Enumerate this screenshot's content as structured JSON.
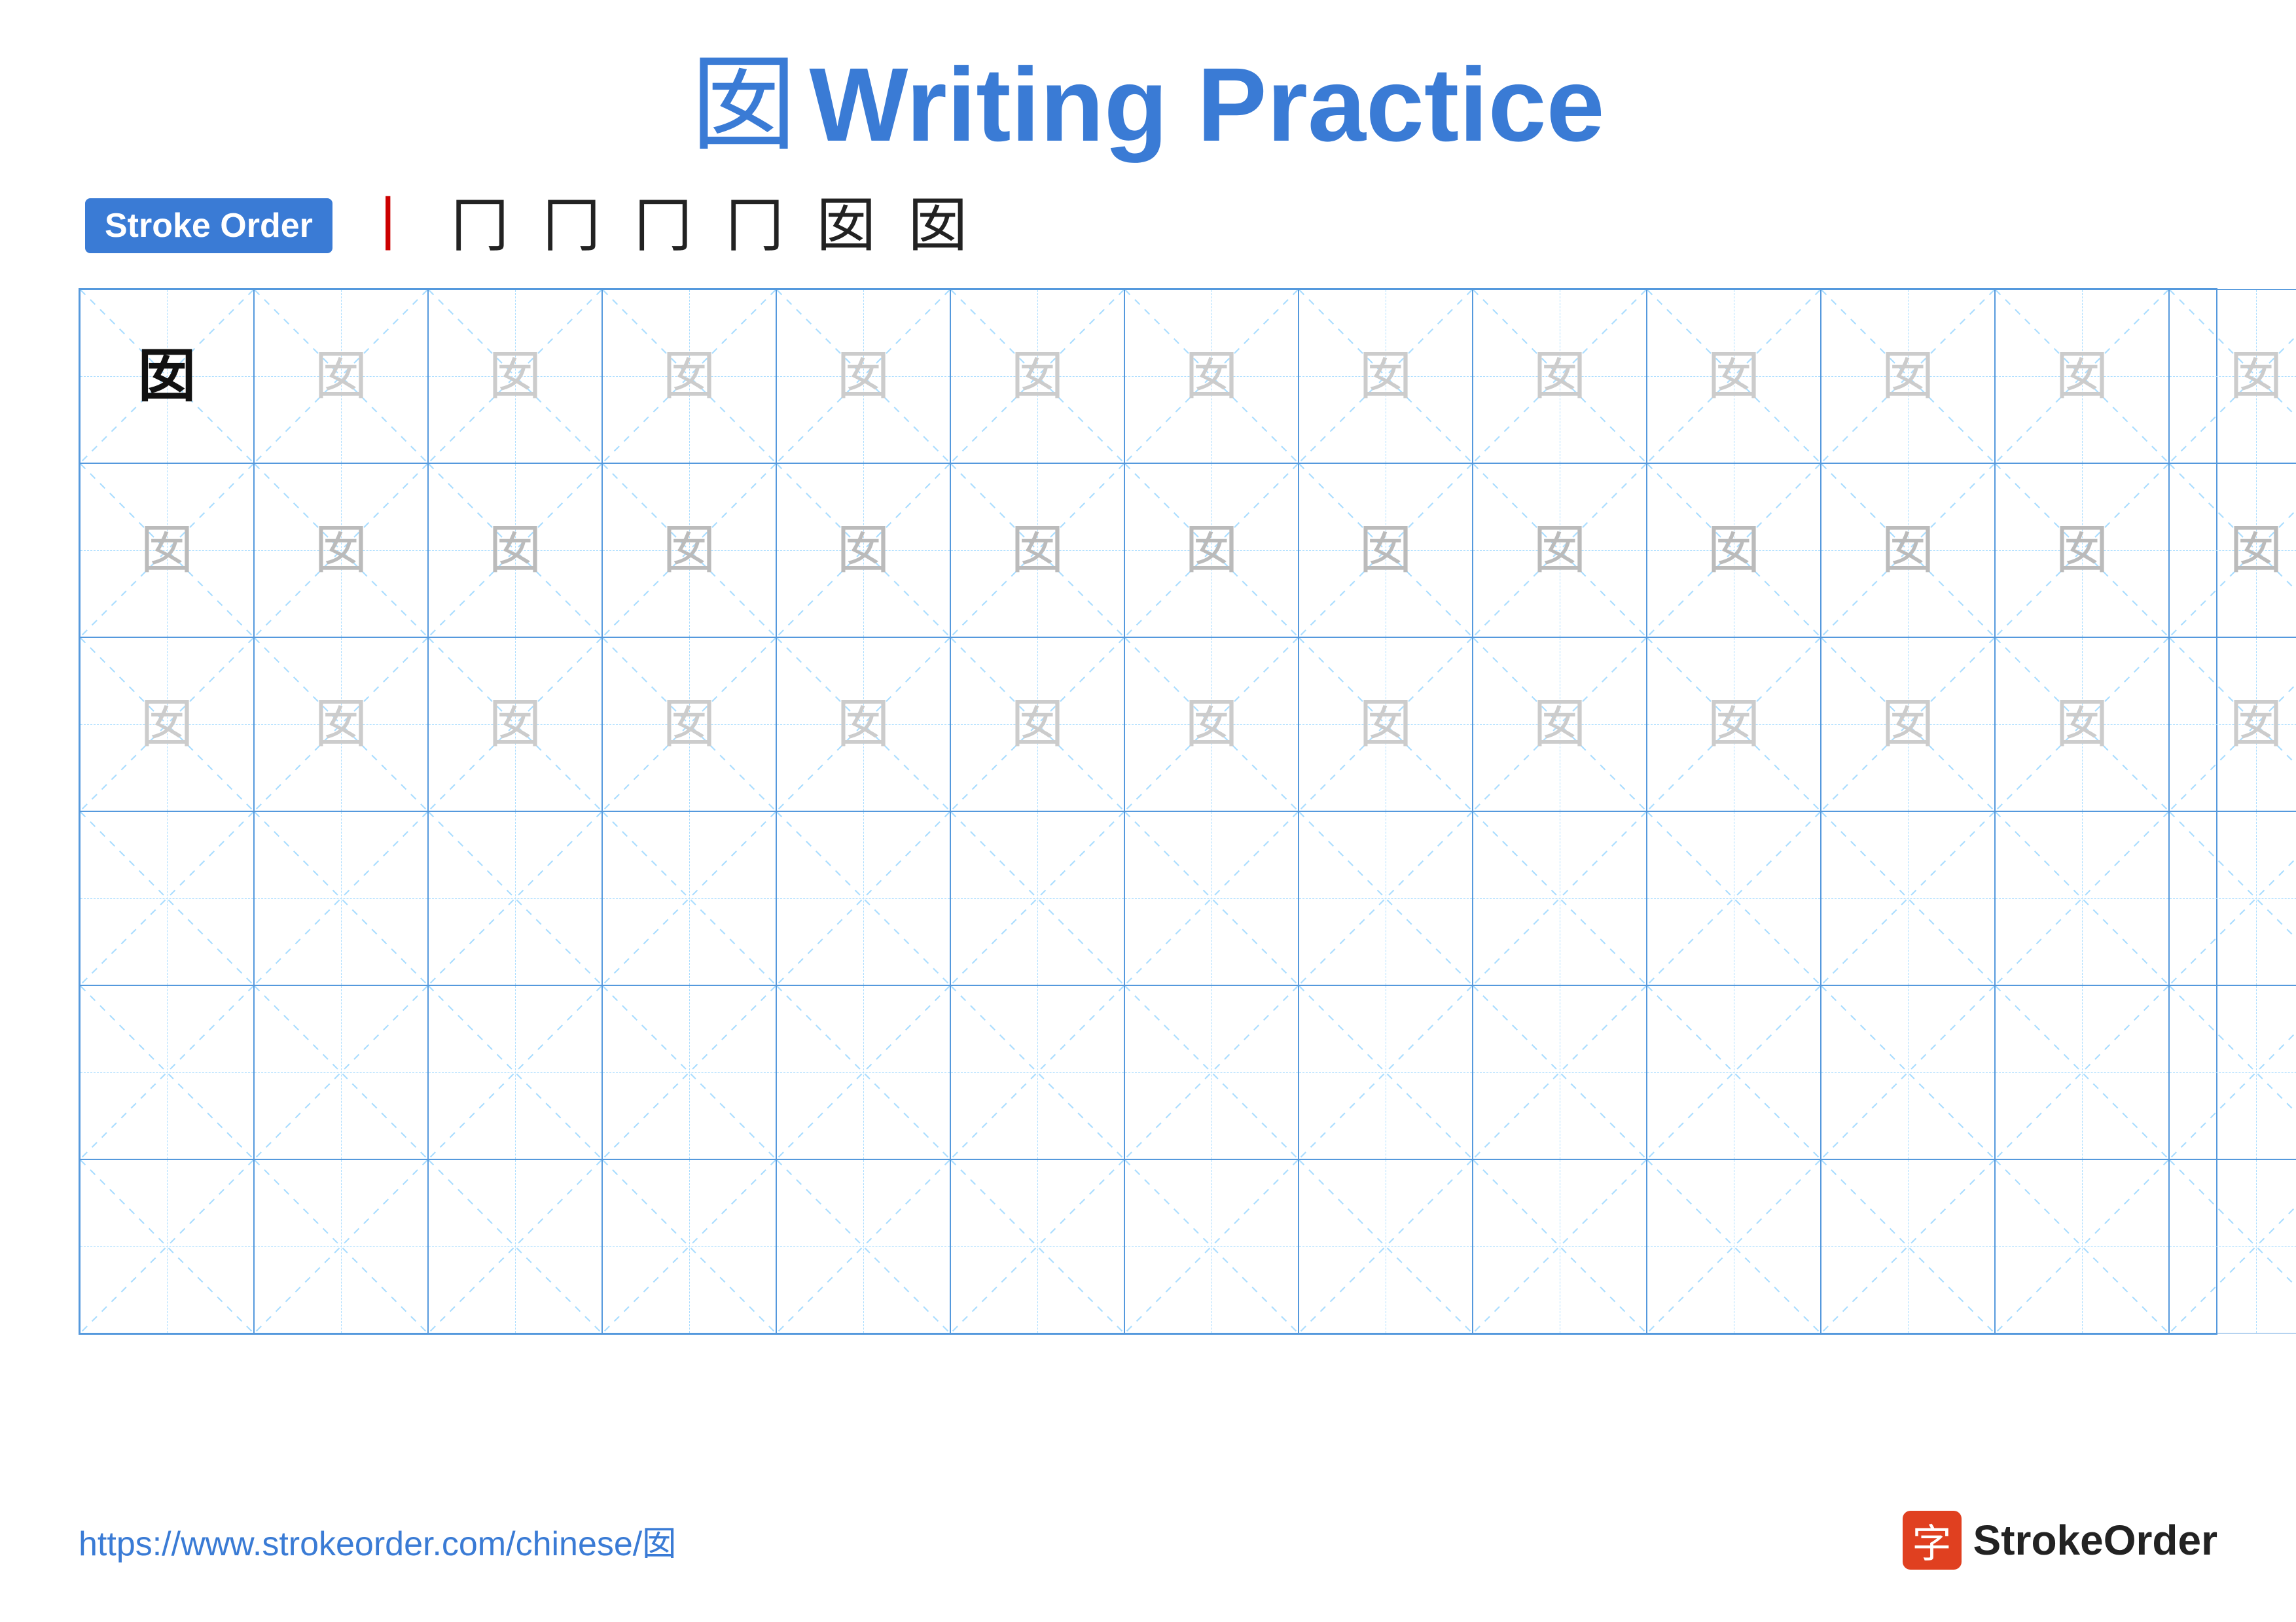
{
  "header": {
    "char": "囡",
    "title": "Writing Practice"
  },
  "stroke_order": {
    "badge_label": "Stroke Order",
    "steps": [
      "丨",
      "冂",
      "冂",
      "冂",
      "冂",
      "囡",
      "囡"
    ]
  },
  "grid": {
    "rows": 6,
    "cols": 13,
    "char": "囡",
    "row1_col1": "bold",
    "filled_rows": 3
  },
  "footer": {
    "url": "https://www.strokeorder.com/chinese/囡",
    "logo_char": "字",
    "logo_text": "StrokeOrder"
  }
}
